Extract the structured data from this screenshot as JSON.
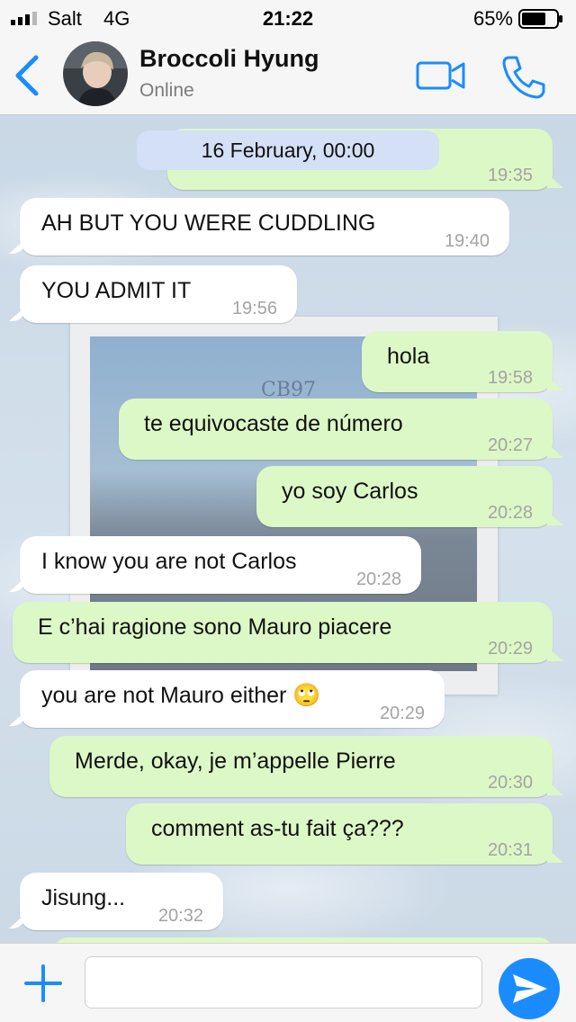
{
  "status_bar": {
    "carrier": "Salt",
    "network": "4G",
    "time": "21:22",
    "battery": "65%"
  },
  "contact": {
    "name": "Broccoli Hyung",
    "status": "Online"
  },
  "colors": {
    "accent": "#1a8cff",
    "outgoing": "#dcf8c6",
    "incoming": "#ffffff",
    "date_pill": "#d3e0f6"
  },
  "icons": [
    "back-chevron-icon",
    "video-call-icon",
    "phone-icon",
    "plus-icon",
    "send-icon"
  ],
  "messages": [
    {
      "direction": "out",
      "text": "",
      "time": "19:35",
      "pill": "16 February, 00:00"
    },
    {
      "direction": "in",
      "text": "AH BUT YOU WERE CUDDLING",
      "time": "19:40"
    },
    {
      "direction": "in",
      "text": "YOU ADMIT IT",
      "time": "19:56"
    },
    {
      "direction": "out",
      "text": "hola",
      "time": "19:58"
    },
    {
      "direction": "out",
      "text": "te equivocaste de número",
      "time": "20:27"
    },
    {
      "direction": "out",
      "text": "yo soy Carlos",
      "time": "20:28"
    },
    {
      "direction": "in",
      "text": "I know you are not Carlos",
      "time": "20:28"
    },
    {
      "direction": "out",
      "text": "E c’hai ragione sono Mauro piacere",
      "time": "20:29"
    },
    {
      "direction": "in",
      "text": "you are not Mauro either 🙄",
      "time": "20:29"
    },
    {
      "direction": "out",
      "text": "Merde, okay, je m’appelle Pierre",
      "time": "20:30"
    },
    {
      "direction": "out",
      "text": "comment as-tu fait ça???",
      "time": "20:31"
    },
    {
      "direction": "in",
      "text": "Jisung...",
      "time": "20:32"
    }
  ],
  "composer": {
    "placeholder": ""
  }
}
